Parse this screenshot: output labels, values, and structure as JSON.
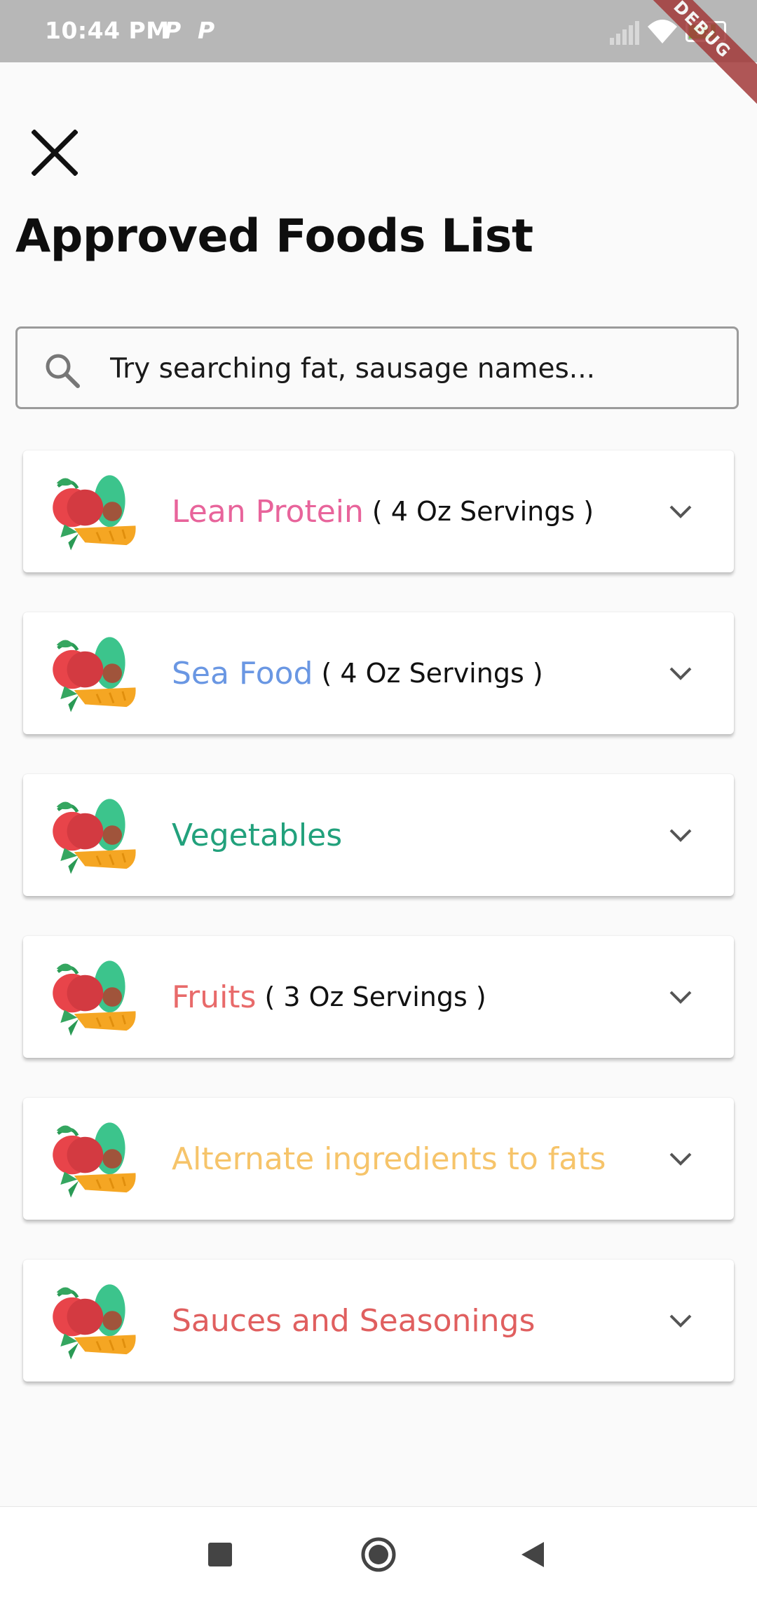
{
  "status_bar": {
    "time": "10:44 PM",
    "notification_icons": [
      "P",
      "P"
    ],
    "battery": "71",
    "debug_banner": "DEBUG"
  },
  "page": {
    "title": "Approved Foods List"
  },
  "search": {
    "placeholder": "Try searching fat, sausage names..."
  },
  "categories": [
    {
      "title": "Lean Protein",
      "subtitle": "( 4 Oz Servings )",
      "color": "#e8649b"
    },
    {
      "title": "Sea Food",
      "subtitle": "( 4 Oz Servings )",
      "color": "#6a97e3"
    },
    {
      "title": "Vegetables",
      "subtitle": "",
      "color": "#22a17c"
    },
    {
      "title": "Fruits",
      "subtitle": "( 3 Oz Servings )",
      "color": "#e86a6a"
    },
    {
      "title": "Alternate ingredients to fats",
      "subtitle": "",
      "color": "#f6c46a"
    },
    {
      "title": "Sauces and Seasonings",
      "subtitle": "",
      "color": "#e05f5f"
    }
  ],
  "icons": {
    "close": "close-icon",
    "search": "search-icon",
    "food": "food-basket-icon",
    "expand": "chevron-down-icon",
    "nav_recents": "square-icon",
    "nav_home": "circle-icon",
    "nav_back": "triangle-back-icon"
  }
}
